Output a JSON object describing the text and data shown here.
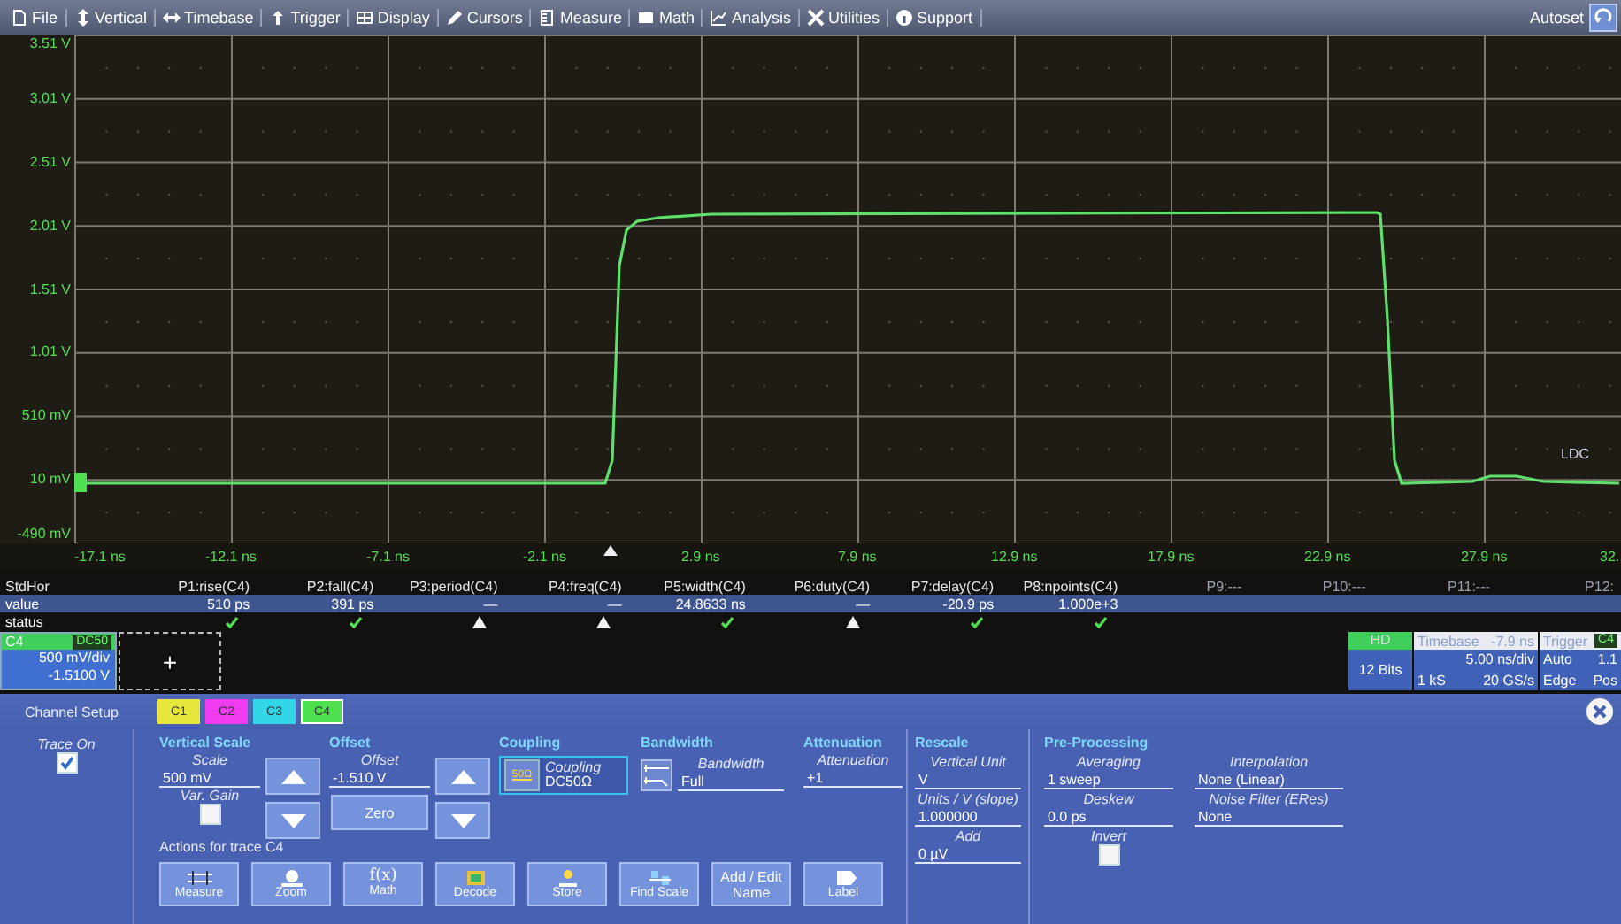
{
  "menu_bar": {
    "items": [
      "File",
      "Vertical",
      "Timebase",
      "Trigger",
      "Display",
      "Cursors",
      "Measure",
      "Math",
      "Analysis",
      "Utilities",
      "Support"
    ],
    "autoset": "Autoset"
  },
  "plot": {
    "y_labels": [
      "3.51 V",
      "3.01 V",
      "2.51 V",
      "2.01 V",
      "1.51 V",
      "1.01 V",
      "510 mV",
      "10 mV",
      "-490 mV"
    ],
    "x_labels": [
      "-17.1 ns",
      "-12.1 ns",
      "-7.1 ns",
      "-2.1 ns",
      "2.9 ns",
      "7.9 ns",
      "12.9 ns",
      "17.9 ns",
      "22.9 ns",
      "27.9 ns",
      "32."
    ],
    "corner_label": "LDC"
  },
  "measurements": {
    "title": "StdHor",
    "value_label": "value",
    "status_label": "status",
    "params": [
      {
        "label": "P1:rise(C4)",
        "value": "510 ps",
        "valid": true
      },
      {
        "label": "P2:fall(C4)",
        "value": "391 ps",
        "valid": true
      },
      {
        "label": "P3:period(C4)",
        "value": "—",
        "valid": false
      },
      {
        "label": "P4:freq(C4)",
        "value": "—",
        "valid": false
      },
      {
        "label": "P5:width(C4)",
        "value": "24.8633 ns",
        "valid": true
      },
      {
        "label": "P6:duty(C4)",
        "value": "—",
        "valid": false
      },
      {
        "label": "P7:delay(C4)",
        "value": "-20.9 ps",
        "valid": true
      },
      {
        "label": "P8:npoints(C4)",
        "value": "1.000e+3",
        "valid": true
      },
      {
        "label": "P9:---"
      },
      {
        "label": "P10:---"
      },
      {
        "label": "P11:---"
      },
      {
        "label": "P12:"
      }
    ]
  },
  "channel_descriptor": {
    "channel": "C4",
    "coupling": "DC50",
    "scale": "500 mV/div",
    "offset": "-1.5100 V"
  },
  "add_button": "+",
  "acquisition": {
    "mode": "HD",
    "bits": "12 Bits"
  },
  "timebase": {
    "title": "Timebase",
    "delay": "-7.9 ns",
    "scale": "5.00 ns/div",
    "samples": "1 kS",
    "rate": "20 GS/s"
  },
  "trigger": {
    "title": "Trigger",
    "source": "C4",
    "mode": "Auto",
    "level": "1.1",
    "type": "Edge",
    "slope": "Pos"
  },
  "dialog": {
    "title": "Channel Setup",
    "tabs": [
      {
        "label": "C1",
        "color": "#e6e63c",
        "selected": false
      },
      {
        "label": "C2",
        "color": "#f03cf0",
        "selected": false
      },
      {
        "label": "C3",
        "color": "#33d6e6",
        "selected": false
      },
      {
        "label": "C4",
        "color": "#4ee04e",
        "selected": true
      }
    ],
    "trace_on": {
      "label": "Trace On",
      "checked": true
    },
    "vertical_scale": {
      "title": "Vertical Scale",
      "field_label": "Scale",
      "value": "500 mV",
      "var_gain_label": "Var. Gain",
      "var_gain": false
    },
    "offset": {
      "title": "Offset",
      "field_label": "Offset",
      "value": "-1.510 V",
      "zero": "Zero"
    },
    "coupling": {
      "title": "Coupling",
      "icon_text": "50Ω",
      "field_label": "Coupling",
      "value": "DC50Ω"
    },
    "bandwidth": {
      "title": "Bandwidth",
      "field_label": "Bandwidth",
      "value": "Full"
    },
    "attenuation": {
      "title": "Attenuation",
      "field_label": "Attenuation",
      "value": "+1"
    },
    "actions": {
      "title": "Actions for trace C4",
      "buttons": [
        {
          "label": "Measure"
        },
        {
          "label": "Zoom"
        },
        {
          "label": "Math",
          "glyph": "f(x)"
        },
        {
          "label": "Decode"
        },
        {
          "label": "Store"
        },
        {
          "label": "Find Scale"
        },
        {
          "label": "Add / Edit Name"
        },
        {
          "label": "Label"
        }
      ]
    },
    "rescale": {
      "title": "Rescale",
      "fields": [
        {
          "label": "Vertical Unit",
          "value": "V"
        },
        {
          "label": "Units / V (slope)",
          "value": "1.000000"
        },
        {
          "label": "Add",
          "value": "0 µV"
        }
      ]
    },
    "pre_processing": {
      "title": "Pre-Processing",
      "averaging": {
        "label": "Averaging",
        "value": "1 sweep"
      },
      "deskew": {
        "label": "Deskew",
        "value": "0.0 ps"
      },
      "invert": {
        "label": "Invert",
        "checked": false
      },
      "interpolation": {
        "label": "Interpolation",
        "value": "None (Linear)"
      },
      "noise_filter": {
        "label": "Noise Filter (ERes)",
        "value": "None"
      }
    }
  }
}
